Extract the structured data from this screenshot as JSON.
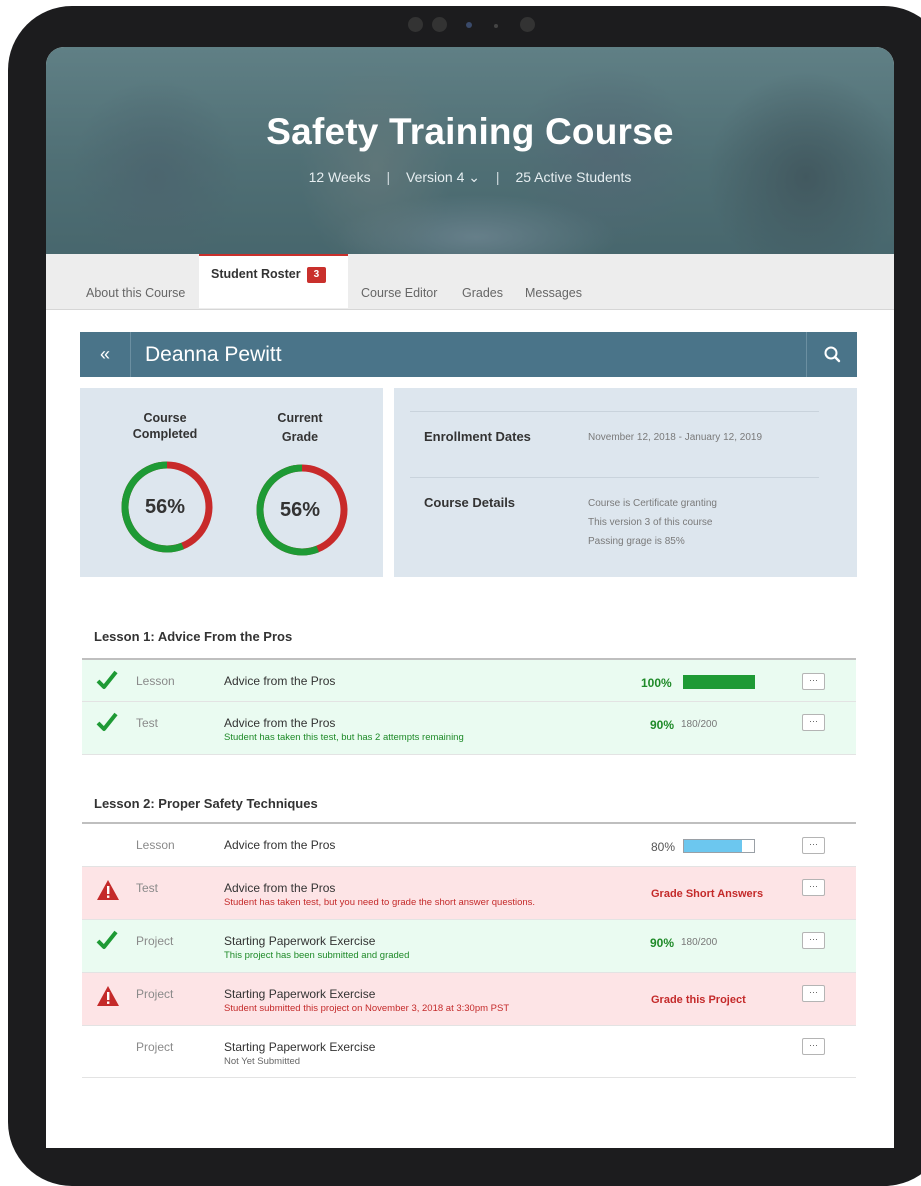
{
  "course": {
    "title": "Safety Training Course",
    "duration": "12 Weeks",
    "version": "Version 4",
    "version_caret": "⌄",
    "students": "25 Active Students"
  },
  "tabs": [
    {
      "label": "About this Course"
    },
    {
      "label": "Student Roster",
      "badge": "3"
    },
    {
      "label": "Course Editor"
    },
    {
      "label": "Grades"
    },
    {
      "label": "Messages"
    }
  ],
  "student": {
    "back_glyph": "«",
    "name": "Deanna Pewitt"
  },
  "stats": [
    {
      "label_line1": "Course",
      "label_line2": "Completed",
      "percent_text": "56%",
      "value": 0.56
    },
    {
      "label_line1": "Current",
      "label_line2": "Grade",
      "percent_text": "56%",
      "value": 0.56
    }
  ],
  "details": {
    "enrollment_title": "Enrollment Dates",
    "enrollment_value": "November 12, 2018 - January 12, 2019",
    "course_title": "Course Details",
    "course_lines": [
      "Course is Certificate granting",
      "This version 3 of this course",
      "Passing grage is 85%"
    ]
  },
  "lessons": [
    {
      "title": "Lesson 1: Advice From the Pros",
      "rows": [
        {
          "state": "done",
          "type": "Lesson",
          "name": "Advice from the Pros",
          "sub": "",
          "pct": "100%",
          "progress": 1.0,
          "score": "",
          "action": "",
          "more": "···"
        },
        {
          "state": "done",
          "type": "Test",
          "name": "Advice from the Pros",
          "sub": "Student has taken this test, but has 2 attempts remaining",
          "pct": "90%",
          "score": "180/200",
          "action": "",
          "more": "···"
        }
      ]
    },
    {
      "title": "Lesson 2: Proper Safety Techniques",
      "rows": [
        {
          "state": "progress",
          "type": "Lesson",
          "name": "Advice from the Pros",
          "sub": "",
          "pct": "80%",
          "progress": 0.8,
          "score": "",
          "action": "",
          "more": "···"
        },
        {
          "state": "alert",
          "type": "Test",
          "name": "Advice from the Pros",
          "sub": "Student has taken test, but you need to grade the short answer questions.",
          "pct": "",
          "score": "",
          "action": "Grade Short Answers",
          "more": "···"
        },
        {
          "state": "done",
          "type": "Project",
          "name": "Starting Paperwork Exercise",
          "sub": "This project has been submitted and graded",
          "pct": "90%",
          "score": "180/200",
          "action": "",
          "more": "···"
        },
        {
          "state": "alert",
          "type": "Project",
          "name": "Starting Paperwork Exercise",
          "sub": "Student submitted this project on November 3, 2018 at 3:30pm PST",
          "pct": "",
          "score": "",
          "action": "Grade this Project",
          "more": "···"
        },
        {
          "state": "pending",
          "type": "Project",
          "name": "Starting Paperwork Exercise",
          "sub": "Not Yet Submitted",
          "pct": "",
          "score": "",
          "action": "",
          "more": "···"
        }
      ]
    }
  ],
  "colors": {
    "accent_red": "#c9302c",
    "header_blue": "#4a7489",
    "complete_green": "#1e9a35",
    "progress_blue": "#6cc7ef",
    "alert_red": "#c42a2a"
  }
}
